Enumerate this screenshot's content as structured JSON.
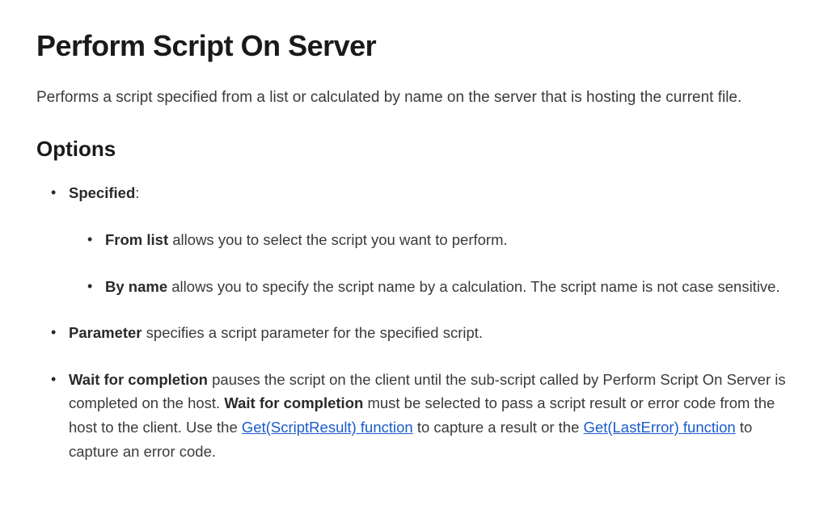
{
  "title": "Perform Script On Server",
  "intro": "Performs a script specified from a list or calculated by name on the server that is hosting the current file.",
  "options_heading": "Options",
  "options": {
    "specified": {
      "label": "Specified",
      "colon": ":",
      "from_list": {
        "label": "From list",
        "text": " allows you to select the script you want to perform."
      },
      "by_name": {
        "label": "By name",
        "text": " allows you to specify the script name by a calculation. The script name is not case sensitive."
      }
    },
    "parameter": {
      "label": "Parameter",
      "text": " specifies a script parameter for the specified script."
    },
    "wait": {
      "label": "Wait for completion",
      "text_1": " pauses the script on the client until the sub-script called by Perform Script On Server is completed on the host. ",
      "label_2": "Wait for completion",
      "text_2": " must be selected to pass a script result or error code from the host to the client. Use the ",
      "link_1": "Get(ScriptResult) function",
      "text_3": " to capture a result or the ",
      "link_2": "Get(LastError) function",
      "text_4": " to capture an error code."
    }
  }
}
